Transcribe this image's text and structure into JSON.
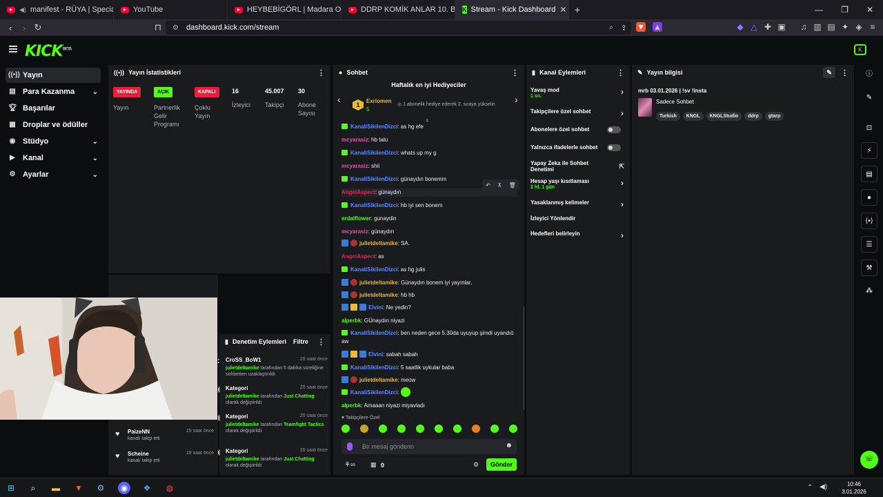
{
  "browser": {
    "tabs": [
      {
        "title": "manifest - RÜYA | Special Dance",
        "active": false
      },
      {
        "title": "YouTube",
        "active": false
      },
      {
        "title": "HEYBEBİGÖRL | Madara Olduk #627",
        "active": false
      },
      {
        "title": "DDRP KOMİK ANLAR 10. BÖLÜM VE",
        "active": false
      },
      {
        "title": "Stream - Kick Dashboard",
        "active": true
      }
    ],
    "new_tab": "+",
    "url": "dashboard.kick.com/stream"
  },
  "logo": {
    "text": "KICK",
    "beta": "BETA"
  },
  "sidebar": {
    "items": [
      {
        "label": "Yayın",
        "icon": "broadcast-icon",
        "active": true
      },
      {
        "label": "Para Kazanma",
        "icon": "money-icon",
        "chevron": true
      },
      {
        "label": "Başarılar",
        "icon": "trophy-icon"
      },
      {
        "label": "Droplar ve ödüller",
        "icon": "gift-icon"
      },
      {
        "label": "Stüdyo",
        "icon": "studio-icon",
        "chevron": true
      },
      {
        "label": "Kanal",
        "icon": "channel-icon",
        "chevron": true
      },
      {
        "label": "Ayarlar",
        "icon": "gear-icon",
        "chevron": true
      }
    ]
  },
  "stats": {
    "title": "Yayın İstatistikleri",
    "badges": [
      {
        "text": "YAYINDA",
        "label": "Yayın",
        "color": "#e91e3b"
      },
      {
        "text": "AÇIK",
        "label": "Partnerlik Gelir Programı",
        "color": "#53fc18"
      },
      {
        "text": "KAPALI",
        "label": "Çoklu Yayın",
        "color": "#e91e3b"
      }
    ],
    "values": [
      {
        "value": "16",
        "label": "İzleyici"
      },
      {
        "value": "45.007",
        "label": "Takipçi"
      },
      {
        "value": "30",
        "label": "Abone Sayısı"
      }
    ]
  },
  "chat": {
    "title": "Sohbet",
    "gifters_title": "Haftalık en iyi Hediyeciler",
    "top_gifter": {
      "rank": "1",
      "name": "Exriomen",
      "count": "5"
    },
    "gifter_hint": "1 abonelik hediye ederek 2. sıraya yükselin",
    "messages": [
      {
        "user": "KanaliSikilenDizci",
        "text": "as hg efe",
        "color": "#5b8cff",
        "icons": [
          "g"
        ]
      },
      {
        "user": "mcyarasiz",
        "text": "hb talu",
        "color": "#e05aa8",
        "icons": []
      },
      {
        "user": "KanaliSikilenDizci",
        "text": "whats up my g",
        "color": "#5b8cff",
        "icons": [
          "g"
        ]
      },
      {
        "user": "mcyarasiz",
        "text": "shii",
        "color": "#e05aa8",
        "icons": []
      },
      {
        "user": "KanaliSikilenDizci",
        "text": "günaydın bonemm",
        "color": "#5b8cff",
        "icons": [
          "g"
        ]
      },
      {
        "user": "AngelAspect",
        "text": "günaydın",
        "color": "#e0245e",
        "icons": []
      },
      {
        "user": "KanaliSikilenDizci",
        "text": "hb iyi sen bonem",
        "color": "#5b8cff",
        "icons": [
          "g"
        ]
      },
      {
        "user": "erdalflower",
        "text": "gunaydin",
        "color": "#53fc18",
        "icons": []
      },
      {
        "user": "mcyarasiz",
        "text": "günaydın",
        "color": "#e05aa8",
        "icons": []
      },
      {
        "user": "julietdeltamike",
        "text": "SA.",
        "color": "#e8b93a",
        "icons": [
          "b",
          "r"
        ]
      },
      {
        "user": "AngelAspect",
        "text": "as",
        "color": "#e0245e",
        "icons": []
      },
      {
        "user": "KanaliSikilenDizci",
        "text": "as hg julis",
        "color": "#5b8cff",
        "icons": [
          "g"
        ]
      },
      {
        "user": "julietdeltamike",
        "text": "Günaydın bonem iyi yayınlar,",
        "color": "#e8b93a",
        "icons": [
          "b",
          "r"
        ]
      },
      {
        "user": "julietdeltamike",
        "text": "hb hb",
        "color": "#e8b93a",
        "icons": [
          "b",
          "r"
        ]
      },
      {
        "user": "Elvini",
        "text": "Ne yedin?",
        "color": "#5b8cff",
        "icons": [
          "b",
          "y",
          "b"
        ]
      },
      {
        "user": "alperbk",
        "text": "GÜnaydın niyazi",
        "color": "#53fc18",
        "icons": []
      },
      {
        "user": "KanaliSikilenDizci",
        "text": "ben neden gece 5.30da uyuyup şimdi uyandıö aw",
        "color": "#5b8cff",
        "icons": [
          "g"
        ]
      },
      {
        "user": "Elvini",
        "text": "sabah sabah",
        "color": "#5b8cff",
        "icons": [
          "b",
          "y",
          "b"
        ]
      },
      {
        "user": "KanaliSikilenDizci",
        "text": "5 saatlik uykular baba",
        "color": "#5b8cff",
        "icons": [
          "g"
        ]
      },
      {
        "user": "julietdeltamike",
        "text": "meow",
        "color": "#e8b93a",
        "icons": [
          "b",
          "r"
        ]
      },
      {
        "user": "KanaliSikilenDizci",
        "text": "",
        "color": "#5b8cff",
        "icons": [
          "g"
        ]
      },
      {
        "user": "alperbk",
        "text": "Amaaan niyazi miyavladı",
        "color": "#53fc18",
        "icons": []
      }
    ],
    "followers_only": "Takipçilere Özel",
    "input_placeholder": "Bir mesaj gönderin",
    "points": "0",
    "send": "Gönder"
  },
  "channel_actions": {
    "title": "Kanal Eylemleri",
    "items": [
      {
        "label": "Yavaş mod",
        "sub": "1 sn.",
        "control": "arrow"
      },
      {
        "label": "Takipçilere özel sohbet",
        "sub": "",
        "control": "arrow"
      },
      {
        "label": "Abonelere özel sohbet",
        "sub": "",
        "control": "toggle"
      },
      {
        "label": "Yalnızca ifadelerle sohbet",
        "sub": "",
        "control": "toggle"
      },
      {
        "label": "Yapay Zeka ile Sohbet Denetimi",
        "sub": "",
        "control": "external"
      },
      {
        "label": "Hesap yaşı kısıtlaması",
        "sub": "2 hf. 1 gün",
        "control": "arrow"
      },
      {
        "label": "Yasaklanmış kelimeler",
        "sub": "",
        "control": "arrow"
      },
      {
        "label": "İzleyici Yönlendir",
        "sub": "",
        "control": "none"
      },
      {
        "label": "Hedefleri belirleyin",
        "sub": "",
        "control": "arrow"
      }
    ]
  },
  "stream_info": {
    "title_label": "Yayın bilgisi",
    "stream_title": "mrb 03.01.2026 | !sv !insta",
    "category": "Sadece Sohbet",
    "tags": [
      "Turkish",
      "KNGL",
      "KNGLStudio",
      "ddrp",
      "gtarp"
    ]
  },
  "mod_actions": {
    "title": "Denetim Eylemleri",
    "filter": "Filtre",
    "items": [
      {
        "title": "CroSS_BoW1",
        "time": "20 saat önce",
        "user": "julietdeltamike",
        "desc": "tarafından 5 dakika süreliğine sohbetten uzaklaştırıldı",
        "icon": "timeout-icon"
      },
      {
        "title": "Kategori",
        "time": "20 saat önce",
        "user": "julietdeltamike",
        "desc_pre": "tarafından",
        "cat": "Just Chatting",
        "desc": "olarak değiştirildi",
        "icon": "category-icon"
      },
      {
        "title": "Kategori",
        "time": "20 saat önce",
        "user": "julietdeltamike",
        "desc_pre": "tarafından",
        "cat": "Teamfight Tactics",
        "desc": "olarak değiştirildi",
        "icon": "category-icon"
      },
      {
        "title": "Kategori",
        "time": "20 saat önce",
        "user": "julietdeltamike",
        "desc_pre": "tarafından",
        "cat": "Just Chatting",
        "desc": "olarak değiştirildi",
        "icon": "category-icon"
      }
    ]
  },
  "followers": {
    "items": [
      {
        "name": "PaizeNN",
        "text": "kanalı takip etti",
        "time": "15 saat önce"
      },
      {
        "name": "Scheine",
        "text": "kanalı takip etti",
        "time": "19 saat önce"
      }
    ]
  },
  "taskbar": {
    "time": "10:46",
    "date": "3.01.2026"
  }
}
